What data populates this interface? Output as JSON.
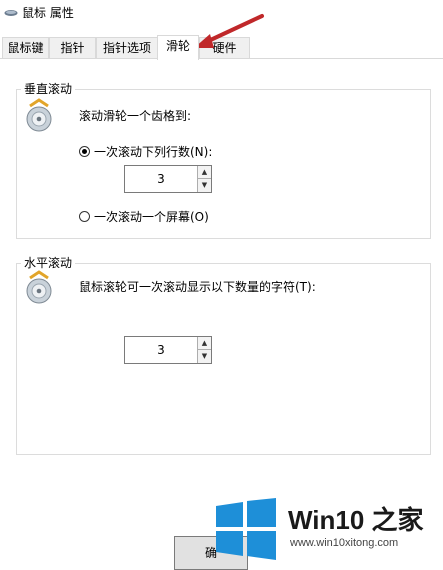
{
  "window": {
    "title": "鼠标 属性"
  },
  "tabs": [
    {
      "label": "鼠标键"
    },
    {
      "label": "指针"
    },
    {
      "label": "指针选项"
    },
    {
      "label": "滑轮",
      "active": true
    },
    {
      "label": "硬件"
    }
  ],
  "vertical_scroll": {
    "group_title": "垂直滚动",
    "description": "滚动滑轮一个齿格到:",
    "option_lines": {
      "label": "一次滚动下列行数(N):",
      "selected": true
    },
    "lines_value": "3",
    "option_screen": {
      "label": "一次滚动一个屏幕(O)",
      "selected": false
    }
  },
  "horizontal_scroll": {
    "group_title": "水平滚动",
    "description": "鼠标滚轮可一次滚动显示以下数量的字符(T):",
    "chars_value": "3"
  },
  "bottom_button": {
    "label": "确"
  },
  "watermark": {
    "title": "Win10 之家",
    "url": "www.win10xitong.com"
  },
  "icons": [
    "mouse-icon",
    "scroll-wheel-icon",
    "arrow-annotation",
    "windows-logo-icon",
    "spin-up-icon",
    "spin-down-icon"
  ],
  "colors": {
    "annotation_arrow": "#c0282a",
    "windows_blue": "#1e8fd8"
  }
}
